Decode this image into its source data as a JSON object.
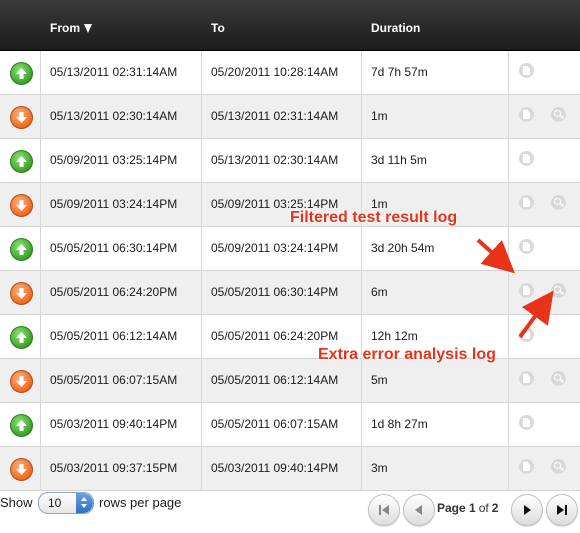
{
  "header": {
    "from": "From",
    "to": "To",
    "duration": "Duration"
  },
  "rows": [
    {
      "status": "up",
      "from": "05/13/2011 02:31:14AM",
      "to": "05/20/2011 10:28:14AM",
      "duration": "7d 7h 57m",
      "has_analysis": false
    },
    {
      "status": "down",
      "from": "05/13/2011 02:30:14AM",
      "to": "05/13/2011 02:31:14AM",
      "duration": "1m",
      "has_analysis": true
    },
    {
      "status": "up",
      "from": "05/09/2011 03:25:14PM",
      "to": "05/13/2011 02:30:14AM",
      "duration": "3d 11h 5m",
      "has_analysis": false
    },
    {
      "status": "down",
      "from": "05/09/2011 03:24:14PM",
      "to": "05/09/2011 03:25:14PM",
      "duration": "1m",
      "has_analysis": true
    },
    {
      "status": "up",
      "from": "05/05/2011 06:30:14PM",
      "to": "05/09/2011 03:24:14PM",
      "duration": "3d 20h 54m",
      "has_analysis": false
    },
    {
      "status": "down",
      "from": "05/05/2011 06:24:20PM",
      "to": "05/05/2011 06:30:14PM",
      "duration": "6m",
      "has_analysis": true
    },
    {
      "status": "up",
      "from": "05/05/2011 06:12:14AM",
      "to": "05/05/2011 06:24:20PM",
      "duration": "12h 12m",
      "has_analysis": false
    },
    {
      "status": "down",
      "from": "05/05/2011 06:07:15AM",
      "to": "05/05/2011 06:12:14AM",
      "duration": "5m",
      "has_analysis": true
    },
    {
      "status": "up",
      "from": "05/03/2011 09:40:14PM",
      "to": "05/05/2011 06:07:15AM",
      "duration": "1d 8h 27m",
      "has_analysis": false
    },
    {
      "status": "down",
      "from": "05/03/2011 09:37:15PM",
      "to": "05/03/2011 09:40:14PM",
      "duration": "3m",
      "has_analysis": true
    }
  ],
  "annotations": {
    "filtered_log": "Filtered test result log",
    "error_log": "Extra error analysis log"
  },
  "footer": {
    "show_label": "Show",
    "rows_value": "10",
    "per_page_label": "rows per page",
    "page_prefix": "Page",
    "current_page": "1",
    "page_of": "of",
    "total_pages": "2"
  },
  "colors": {
    "header_bg": "#1c1c1c",
    "up": "#3da028",
    "down": "#ee6a1e",
    "annotation": "#e8331a"
  },
  "icons": {
    "status_up": "arrow-up-circle-icon",
    "status_down": "arrow-down-circle-icon",
    "log": "document-icon",
    "analysis": "magnifier-icon"
  }
}
